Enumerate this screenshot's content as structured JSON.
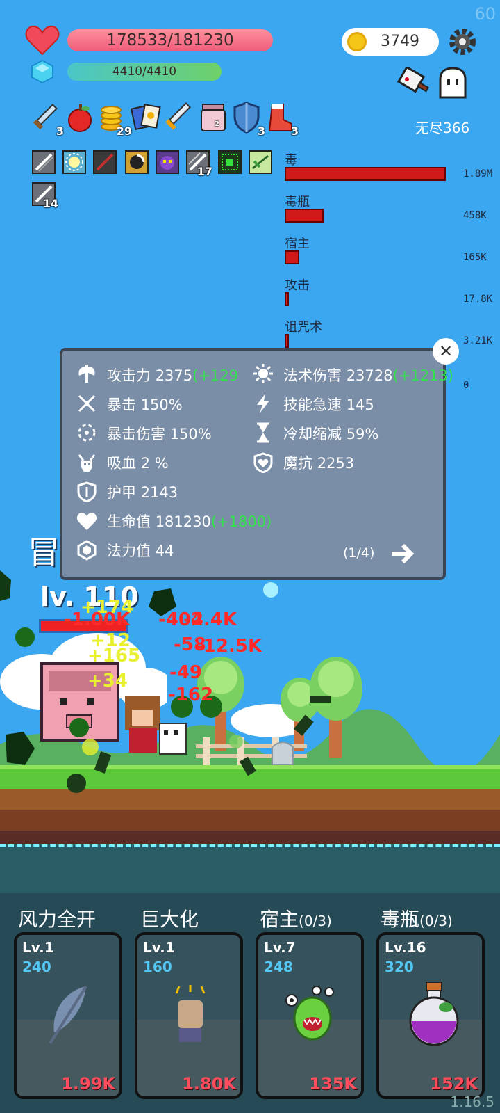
{
  "hud": {
    "fps": "60",
    "hp_text": "178533/181230",
    "hp_fraction": 0.985,
    "mp_text": "4410/4410",
    "mp_fraction": 1.0,
    "gold": "3749",
    "mode_label": "无尽366"
  },
  "items": [
    {
      "icon": "sword-icon",
      "count": "3"
    },
    {
      "icon": "apple-icon",
      "count": ""
    },
    {
      "icon": "coins-icon",
      "count": "29"
    },
    {
      "icon": "cards-icon",
      "count": ""
    },
    {
      "icon": "sword2-icon",
      "count": ""
    },
    {
      "icon": "jar-icon",
      "count": "2"
    },
    {
      "icon": "shield-icon",
      "count": "3"
    },
    {
      "icon": "boot-icon",
      "count": "3"
    }
  ],
  "skill_icons": [
    {
      "icon": "slash-skill-icon",
      "count": ""
    },
    {
      "icon": "light-skill-icon",
      "count": ""
    },
    {
      "icon": "dark-slash-skill-icon",
      "count": ""
    },
    {
      "icon": "spin-skill-icon",
      "count": ""
    },
    {
      "icon": "demon-skill-icon",
      "count": ""
    },
    {
      "icon": "slash2-skill-icon",
      "count": "17"
    },
    {
      "icon": "matrix-skill-icon",
      "count": ""
    },
    {
      "icon": "leaf-skill-icon",
      "count": ""
    },
    {
      "icon": "slash3-skill-icon",
      "count": "14"
    }
  ],
  "damage_stats": [
    {
      "label": "毒",
      "value": "1.89M",
      "fraction": 1.0
    },
    {
      "label": "毒瓶",
      "value": "458K",
      "fraction": 0.24
    },
    {
      "label": "宿主",
      "value": "165K",
      "fraction": 0.09
    },
    {
      "label": "攻击",
      "value": "17.8K",
      "fraction": 0.01
    },
    {
      "label": "诅咒术",
      "value": "3.21K",
      "fraction": 0.002
    },
    {
      "label": "",
      "value": "0",
      "fraction": 0
    }
  ],
  "stats_panel": {
    "left": [
      {
        "icon": "axe-icon",
        "label": "攻击力",
        "value": "2375",
        "bonus": "(+129"
      },
      {
        "icon": "crit-icon",
        "label": "暴击",
        "value": "150%",
        "bonus": ""
      },
      {
        "icon": "crit-damage-icon",
        "label": "暴击伤害",
        "value": "150%",
        "bonus": ""
      },
      {
        "icon": "lifesteal-icon",
        "label": "吸血",
        "value": "2 %",
        "bonus": ""
      },
      {
        "icon": "armor-icon",
        "label": "护甲",
        "value": "2143",
        "bonus": ""
      },
      {
        "icon": "heart-icon",
        "label": "生命值",
        "value": "181230",
        "bonus": "(+1800)"
      },
      {
        "icon": "mana-icon",
        "label": "法力值",
        "value": "44",
        "bonus": ""
      }
    ],
    "right": [
      {
        "icon": "spell-icon",
        "label": "法术伤害",
        "value": "23728",
        "bonus": "(+1213)"
      },
      {
        "icon": "haste-icon",
        "label": "技能急速",
        "value": "145",
        "bonus": ""
      },
      {
        "icon": "hourglass-icon",
        "label": "冷却缩减",
        "value": "59%",
        "bonus": ""
      },
      {
        "icon": "magic-resist-icon",
        "label": "魔抗",
        "value": "2253",
        "bonus": ""
      }
    ],
    "page": "(1/4)",
    "close_symbol": "✕"
  },
  "battle": {
    "enemy_level": "lv. 110",
    "side_char": "冒",
    "floating_texts": [
      {
        "text": "+174",
        "color": "#e8f030"
      },
      {
        "text": "-1.00K",
        "color": "#ff2a2a"
      },
      {
        "text": "-402",
        "color": "#ff2a2a"
      },
      {
        "text": "-4.4K",
        "color": "#ff2a2a"
      },
      {
        "text": "-12.5K",
        "color": "#ff2a2a"
      },
      {
        "text": "+12",
        "color": "#e8f030"
      },
      {
        "text": "+165",
        "color": "#e8f030"
      },
      {
        "text": "+34",
        "color": "#e8f030"
      },
      {
        "text": "-58",
        "color": "#ff2a2a"
      },
      {
        "text": "-49",
        "color": "#ff2a2a"
      },
      {
        "text": "-162",
        "color": "#ff2a2a"
      }
    ]
  },
  "skill_cards": [
    {
      "title": "风力全开",
      "progress": "",
      "level": "Lv.1",
      "cost": "240",
      "price": "1.99K",
      "icon": "feather-icon"
    },
    {
      "title": "巨大化",
      "progress": "",
      "level": "Lv.1",
      "cost": "160",
      "price": "1.80K",
      "icon": "fist-icon"
    },
    {
      "title": "宿主",
      "progress": "(0/3)",
      "level": "Lv.7",
      "cost": "248",
      "price": "135K",
      "icon": "virus-monster-icon"
    },
    {
      "title": "毒瓶",
      "progress": "(0/3)",
      "level": "Lv.16",
      "cost": "320",
      "price": "152K",
      "icon": "poison-bottle-icon"
    }
  ],
  "version": "1.16.5"
}
